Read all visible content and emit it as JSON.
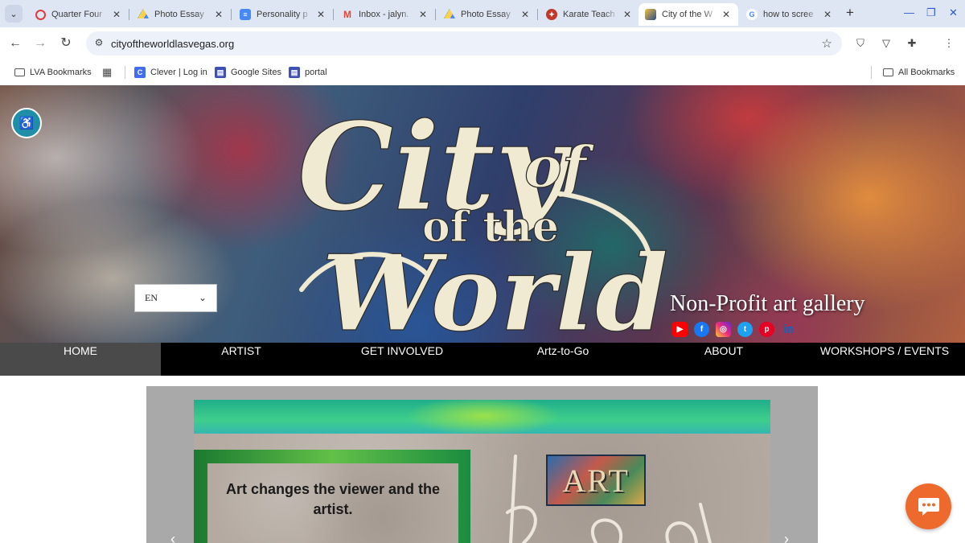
{
  "browser": {
    "tabs": [
      {
        "title": "Quarter Four",
        "favicon": "red-ring-icon",
        "active": false
      },
      {
        "title": "Photo Essay",
        "favicon": "google-drive-icon",
        "active": false
      },
      {
        "title": "Personality p",
        "favicon": "google-docs-icon",
        "active": false
      },
      {
        "title": "Inbox - jalyn.",
        "favicon": "gmail-icon",
        "active": false
      },
      {
        "title": "Photo Essay",
        "favicon": "google-drive-icon",
        "active": false
      },
      {
        "title": "Karate Teach",
        "favicon": "karate-logo-icon",
        "active": false
      },
      {
        "title": "City of the W",
        "favicon": "city-of-the-world-icon",
        "active": true
      },
      {
        "title": "how to scree",
        "favicon": "google-g-icon",
        "active": false
      }
    ],
    "url": "cityoftheworldlasvegas.org",
    "bookmarks": [
      {
        "label": "LVA Bookmarks",
        "icon": "folder-icon"
      },
      {
        "label": "Clever | Log in",
        "icon": "clever-icon"
      },
      {
        "label": "Google Sites",
        "icon": "google-sites-icon"
      },
      {
        "label": "portal",
        "icon": "portal-icon"
      }
    ],
    "all_bookmarks": "All Bookmarks"
  },
  "site": {
    "logo_lines": [
      "City",
      "of",
      "of the",
      "World"
    ],
    "language": "EN",
    "tagline": "Non-Profit art gallery",
    "socials": [
      {
        "name": "youtube",
        "glyph": "▶",
        "color": "#ff0000"
      },
      {
        "name": "facebook",
        "glyph": "f",
        "color": "#1877f2"
      },
      {
        "name": "instagram",
        "glyph": "◎",
        "color": "#c13584"
      },
      {
        "name": "twitter",
        "glyph": "t",
        "color": "#1da1f2"
      },
      {
        "name": "pinterest",
        "glyph": "p",
        "color": "#e60023"
      },
      {
        "name": "linkedin",
        "glyph": "in",
        "color": "#0a66c2"
      }
    ],
    "nav": [
      "HOME",
      "ARTIST",
      "GET INVOLVED",
      "Artz-to-Go",
      "ABOUT",
      "WORKSHOPS / EVENTS"
    ],
    "active_nav": "HOME",
    "slide": {
      "quote": "Art changes the viewer and the artist.",
      "plaque": "ART"
    }
  }
}
